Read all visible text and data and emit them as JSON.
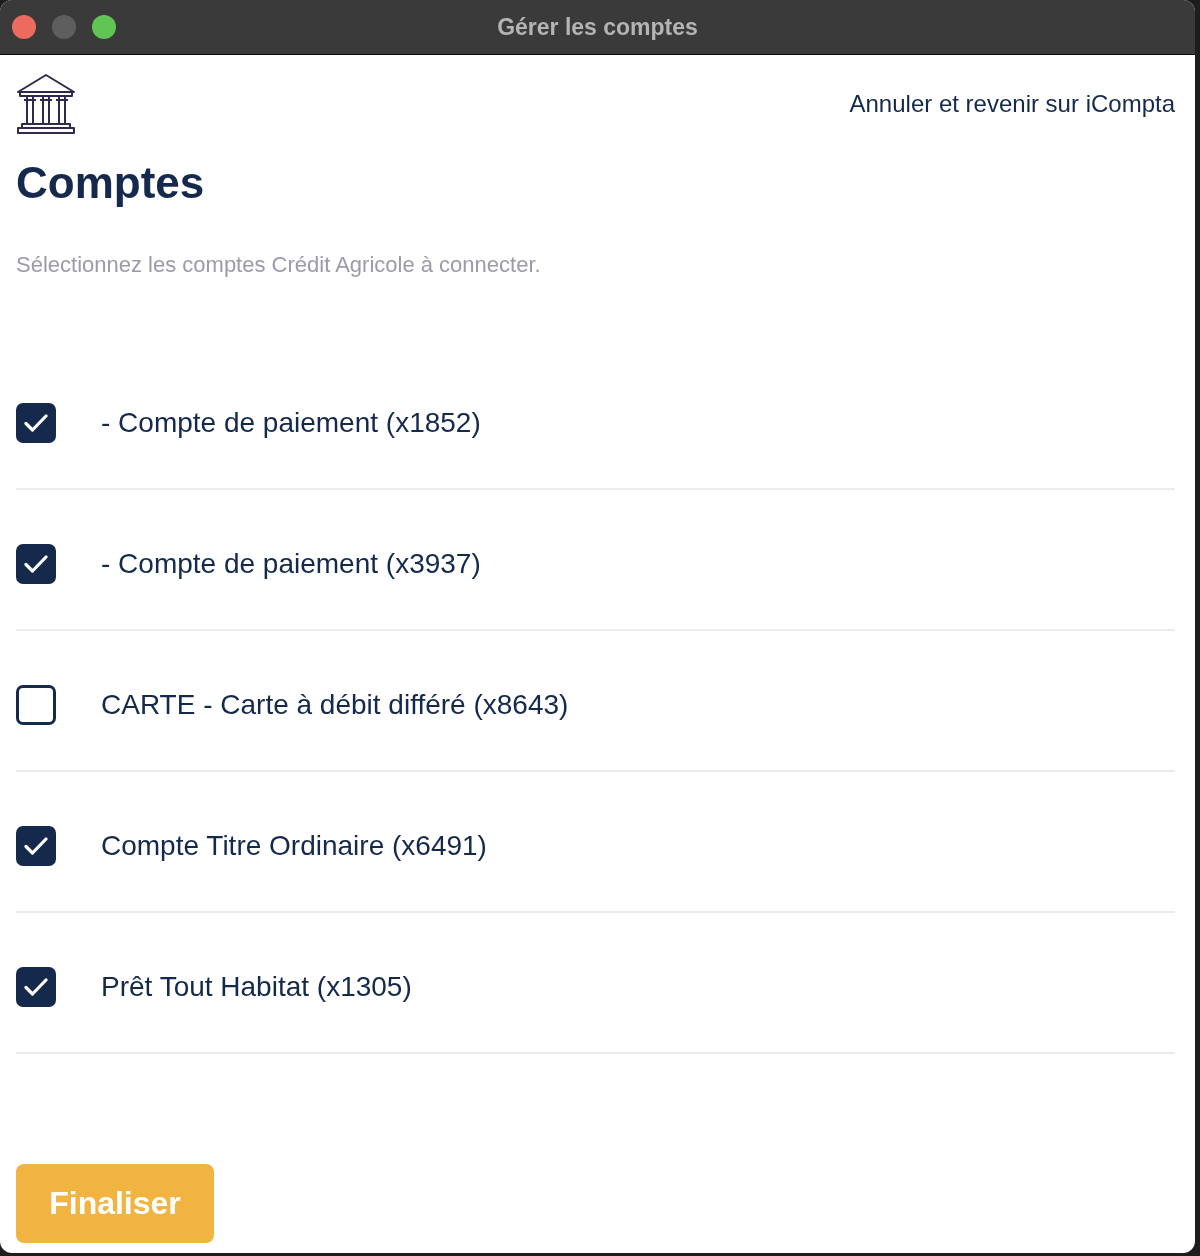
{
  "window": {
    "title": "Gérer les comptes",
    "controls": [
      {
        "kind": "close",
        "disabled": false
      },
      {
        "kind": "minimize",
        "disabled": true
      },
      {
        "kind": "zoom",
        "disabled": false
      }
    ]
  },
  "header": {
    "cancel_link": "Annuler et revenir sur iCompta"
  },
  "heading": "Comptes",
  "subtitle": "Sélectionnez les comptes Crédit Agricole à connecter.",
  "accounts": [
    {
      "label": "- Compte de paiement (x1852)",
      "checked": true
    },
    {
      "label": "- Compte de paiement (x3937)",
      "checked": true
    },
    {
      "label": "CARTE - Carte à débit différé (x8643)",
      "checked": false
    },
    {
      "label": "Compte Titre Ordinaire (x6491)",
      "checked": true
    },
    {
      "label": "Prêt Tout Habitat (x1305)",
      "checked": true
    }
  ],
  "finish_button": {
    "label": "Finaliser"
  }
}
